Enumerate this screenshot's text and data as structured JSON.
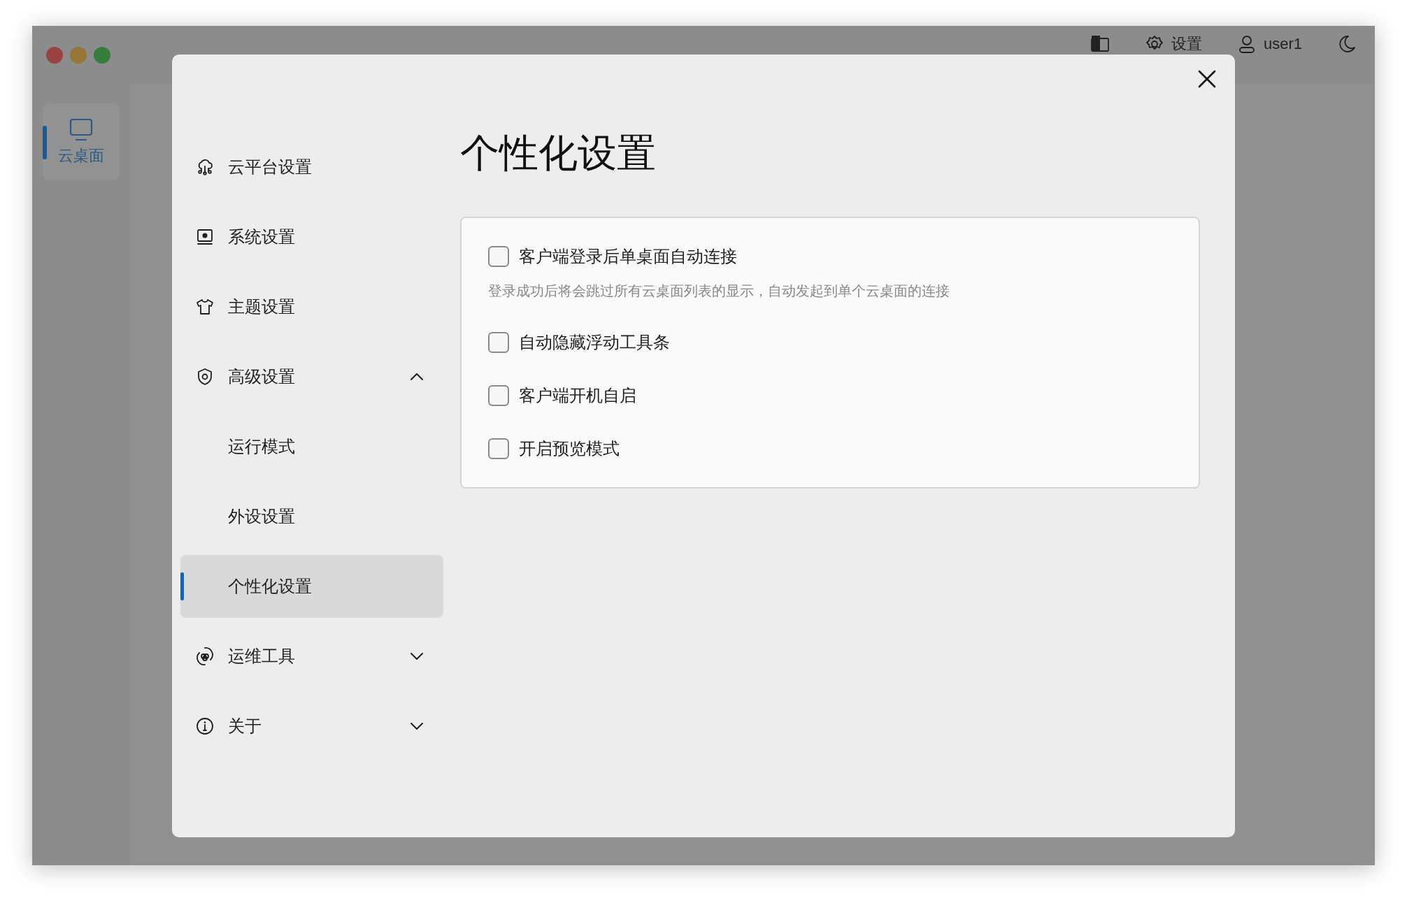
{
  "top_bar": {
    "settings_label": "设置",
    "user": "user1"
  },
  "rail": [
    {
      "label": "云桌面",
      "selected": true
    }
  ],
  "dialog": {
    "title": "个性化设置",
    "nav": [
      {
        "label": "云平台设置",
        "kind": "cloud",
        "selected": false
      },
      {
        "label": "系统设置",
        "kind": "system",
        "selected": false
      },
      {
        "label": "主题设置",
        "kind": "shirt",
        "selected": false
      },
      {
        "label": "高级设置",
        "kind": "shield",
        "selected": false,
        "expanded": true,
        "children": [
          {
            "label": "运行模式",
            "selected": false
          },
          {
            "label": "外设设置",
            "selected": false
          },
          {
            "label": "个性化设置",
            "selected": true
          }
        ]
      },
      {
        "label": "运维工具",
        "kind": "tools",
        "selected": false,
        "expanded": false
      },
      {
        "label": "关于",
        "kind": "info",
        "selected": false,
        "expanded": false
      }
    ],
    "options": [
      {
        "label": "客户端登录后单桌面自动连接",
        "checked": false,
        "description": "登录成功后将会跳过所有云桌面列表的显示，自动发起到单个云桌面的连接"
      },
      {
        "label": "自动隐藏浮动工具条",
        "checked": false
      },
      {
        "label": "客户端开机自启",
        "checked": false
      },
      {
        "label": "开启预览模式",
        "checked": false
      }
    ]
  }
}
